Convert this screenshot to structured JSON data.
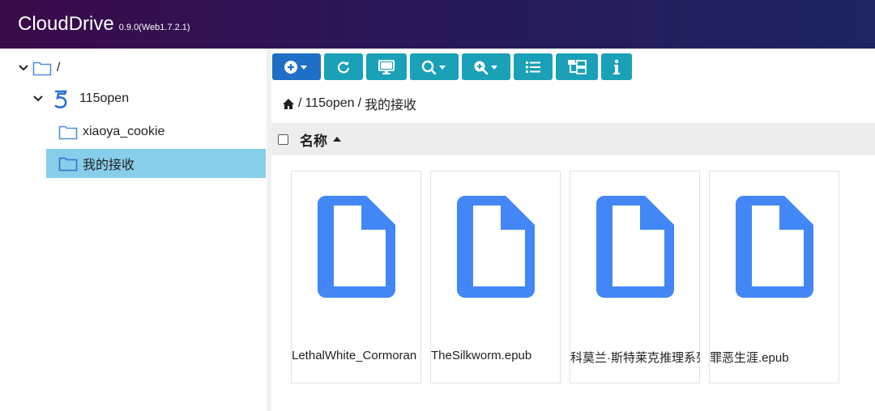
{
  "app": {
    "brand": "CloudDrive",
    "version": "0.9.0(Web1.7.2.1)"
  },
  "sidebar": {
    "root": {
      "label": "/"
    },
    "items": [
      {
        "label": "115open",
        "icon": "115-logo-icon"
      },
      {
        "label": "xiaoya_cookie",
        "icon": "folder-icon"
      },
      {
        "label": "我的接收",
        "icon": "folder-icon",
        "selected": true
      }
    ]
  },
  "toolbar": {
    "buttons": [
      {
        "name": "add-menu-button",
        "icon": "plus-circle-dropdown-icon"
      },
      {
        "name": "refresh-button",
        "icon": "refresh-icon"
      },
      {
        "name": "display-button",
        "icon": "monitor-icon"
      },
      {
        "name": "search-menu-button",
        "icon": "search-dropdown-icon"
      },
      {
        "name": "zoom-menu-button",
        "icon": "zoom-in-dropdown-icon"
      },
      {
        "name": "list-view-button",
        "icon": "list-icon"
      },
      {
        "name": "tree-view-button",
        "icon": "sitemap-icon"
      },
      {
        "name": "info-button",
        "icon": "info-icon"
      }
    ]
  },
  "breadcrumb": {
    "segments": [
      "115open",
      "我的接收"
    ],
    "separator": "/"
  },
  "list": {
    "column_name": "名称",
    "sort": "asc"
  },
  "files": [
    {
      "name": "LethalWhite_Cormoran"
    },
    {
      "name": "TheSilkworm.epub"
    },
    {
      "name": "科莫兰·斯特莱克推理系列"
    },
    {
      "name": "罪恶生涯.epub"
    }
  ],
  "colors": {
    "accent_primary": "#1f6fc7",
    "accent_teal": "#1aa1b8",
    "selected_row": "#87ceeb",
    "file_icon": "#4287f5"
  }
}
